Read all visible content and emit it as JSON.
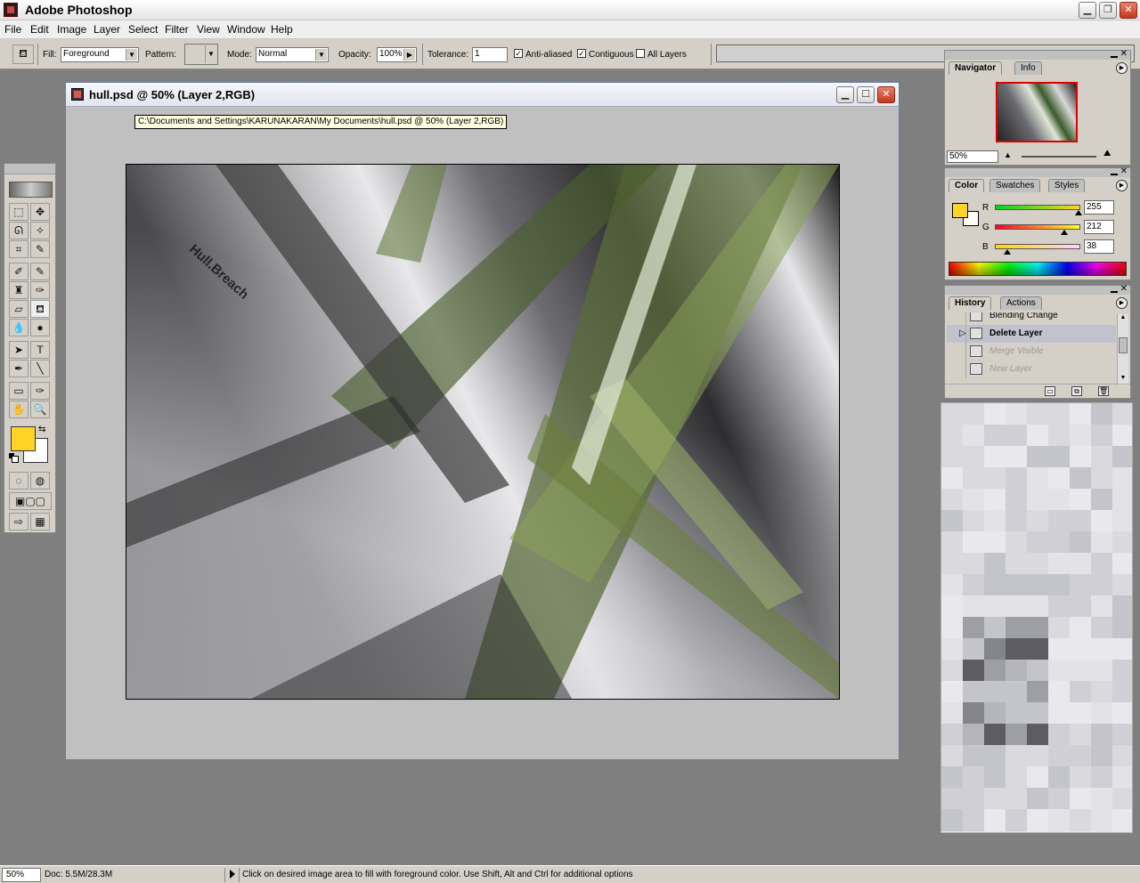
{
  "app": {
    "title": "Adobe Photoshop"
  },
  "menu": [
    "File",
    "Edit",
    "Image",
    "Layer",
    "Select",
    "Filter",
    "View",
    "Window",
    "Help"
  ],
  "options": {
    "fill_label": "Fill:",
    "fill_value": "Foreground",
    "pattern_label": "Pattern:",
    "mode_label": "Mode:",
    "mode_value": "Normal",
    "opacity_label": "Opacity:",
    "opacity_value": "100%",
    "tolerance_label": "Tolerance:",
    "tolerance_value": "1",
    "anti_aliased": "Anti-aliased",
    "contiguous": "Contiguous",
    "all_layers": "All Layers",
    "anti_aliased_checked": true,
    "contiguous_checked": true,
    "all_layers_checked": false
  },
  "document": {
    "title": "hull.psd @ 50% (Layer 2,RGB)",
    "tooltip": "C:\\Documents and Settings\\KARUNAKARAN\\My Documents\\hull.psd @ 50% (Layer 2,RGB)",
    "watermark": "Hull.Breach"
  },
  "navigator": {
    "tabs": [
      "Navigator",
      "Info"
    ],
    "zoom": "50%"
  },
  "color": {
    "tabs": [
      "Color",
      "Swatches",
      "Styles"
    ],
    "channels": [
      {
        "label": "R",
        "value": "255"
      },
      {
        "label": "G",
        "value": "212"
      },
      {
        "label": "B",
        "value": "38"
      }
    ],
    "foreground": "#ffd426",
    "background": "#ffffff"
  },
  "history": {
    "tabs": [
      "History",
      "Actions"
    ],
    "items": [
      {
        "label": "Blending Change",
        "state": "partial"
      },
      {
        "label": "Delete Layer",
        "state": "active"
      },
      {
        "label": "Merge Visible",
        "state": "undone"
      },
      {
        "label": "New Layer",
        "state": "undone"
      }
    ]
  },
  "status": {
    "zoom": "50%",
    "doc": "Doc: 5.5M/28.3M",
    "message": "Click on desired image area to fill with foreground color.  Use Shift, Alt and Ctrl for additional options"
  }
}
